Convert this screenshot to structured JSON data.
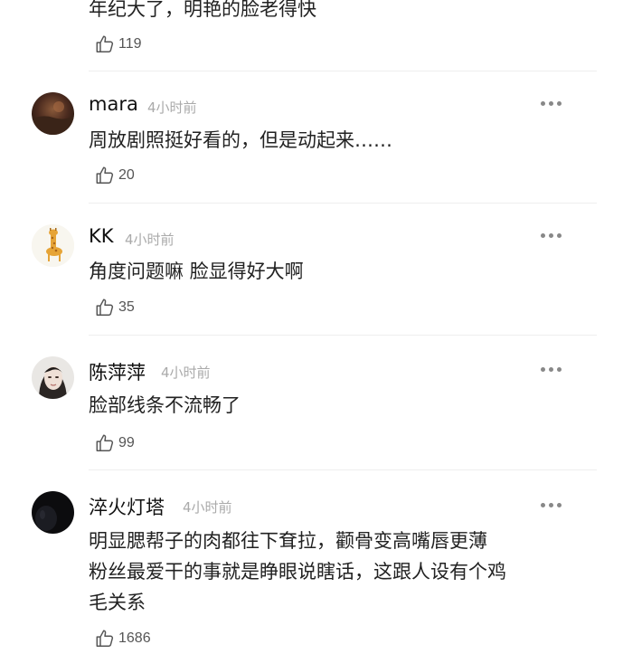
{
  "comments": [
    {
      "lines": [
        "年纪大了，明艳的脸老得快"
      ],
      "likes": "119"
    },
    {
      "username": "mara",
      "time": "4小时前",
      "lines": [
        "周放剧照挺好看的，但是动起来……"
      ],
      "likes": "20"
    },
    {
      "username": "KK",
      "time": "4小时前",
      "lines": [
        "角度问题嘛 脸显得好大啊"
      ],
      "likes": "35"
    },
    {
      "username": "陈萍萍",
      "time": "4小时前",
      "lines": [
        "脸部线条不流畅了"
      ],
      "likes": "99"
    },
    {
      "username": "淬火灯塔",
      "time": "4小时前",
      "lines": [
        "明显腮帮子的肉都往下耷拉，颧骨变高嘴唇更薄",
        "粉丝最爱干的事就是睁眼说瞎话，这跟人设有个鸡",
        "毛关系"
      ],
      "likes": "1686"
    }
  ],
  "icons": {
    "like": "thumbs-up-icon",
    "more": "more-options-icon"
  },
  "colors": {
    "username": "#111111",
    "time": "#aaaaaa",
    "text": "#222222",
    "like_count": "#555555",
    "divider": "#eeeeee"
  }
}
